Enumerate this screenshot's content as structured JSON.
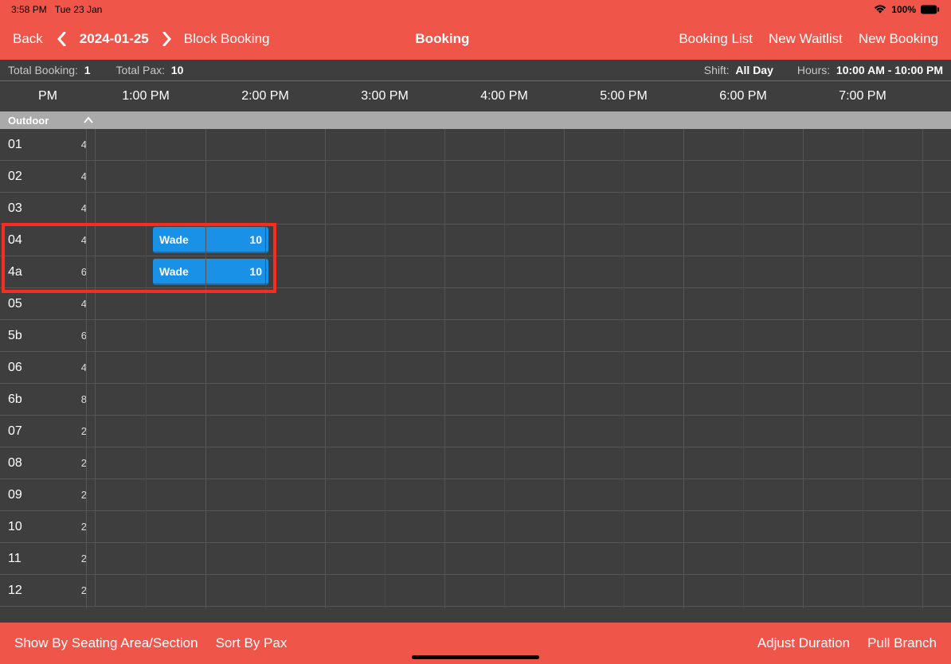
{
  "status": {
    "time": "3:58 PM",
    "date": "Tue 23 Jan",
    "battery": "100%"
  },
  "nav": {
    "back": "Back",
    "date": "2024-01-25",
    "block_booking": "Block Booking",
    "title": "Booking",
    "booking_list": "Booking List",
    "new_waitlist": "New Waitlist",
    "new_booking": "New Booking"
  },
  "info": {
    "total_booking_label": "Total Booking:",
    "total_booking_val": "1",
    "total_pax_label": "Total Pax:",
    "total_pax_val": "10",
    "shift_label": "Shift:",
    "shift_val": "All Day",
    "hours_label": "Hours:",
    "hours_val": "10:00 AM - 10:00 PM"
  },
  "timeline": {
    "first_col": "PM",
    "times": [
      "1:00 PM",
      "2:00 PM",
      "3:00 PM",
      "4:00 PM",
      "5:00 PM",
      "6:00 PM",
      "7:00 PM"
    ]
  },
  "section": {
    "name": "Outdoor"
  },
  "tables": [
    {
      "name": "01",
      "cap": "4"
    },
    {
      "name": "02",
      "cap": "4"
    },
    {
      "name": "03",
      "cap": "4"
    },
    {
      "name": "04",
      "cap": "4"
    },
    {
      "name": "4a",
      "cap": "6"
    },
    {
      "name": "05",
      "cap": "4"
    },
    {
      "name": "5b",
      "cap": "6"
    },
    {
      "name": "06",
      "cap": "4"
    },
    {
      "name": "6b",
      "cap": "8"
    },
    {
      "name": "07",
      "cap": "2"
    },
    {
      "name": "08",
      "cap": "2"
    },
    {
      "name": "09",
      "cap": "2"
    },
    {
      "name": "10",
      "cap": "2"
    },
    {
      "name": "11",
      "cap": "2"
    },
    {
      "name": "12",
      "cap": "2"
    }
  ],
  "bookings": [
    {
      "row": 3,
      "name": "Wade",
      "pax": "10"
    },
    {
      "row": 4,
      "name": "Wade",
      "pax": "10"
    }
  ],
  "footer": {
    "show_by": "Show By Seating Area/Section",
    "sort_by": "Sort By Pax",
    "adjust": "Adjust Duration",
    "pull": "Pull Branch"
  }
}
